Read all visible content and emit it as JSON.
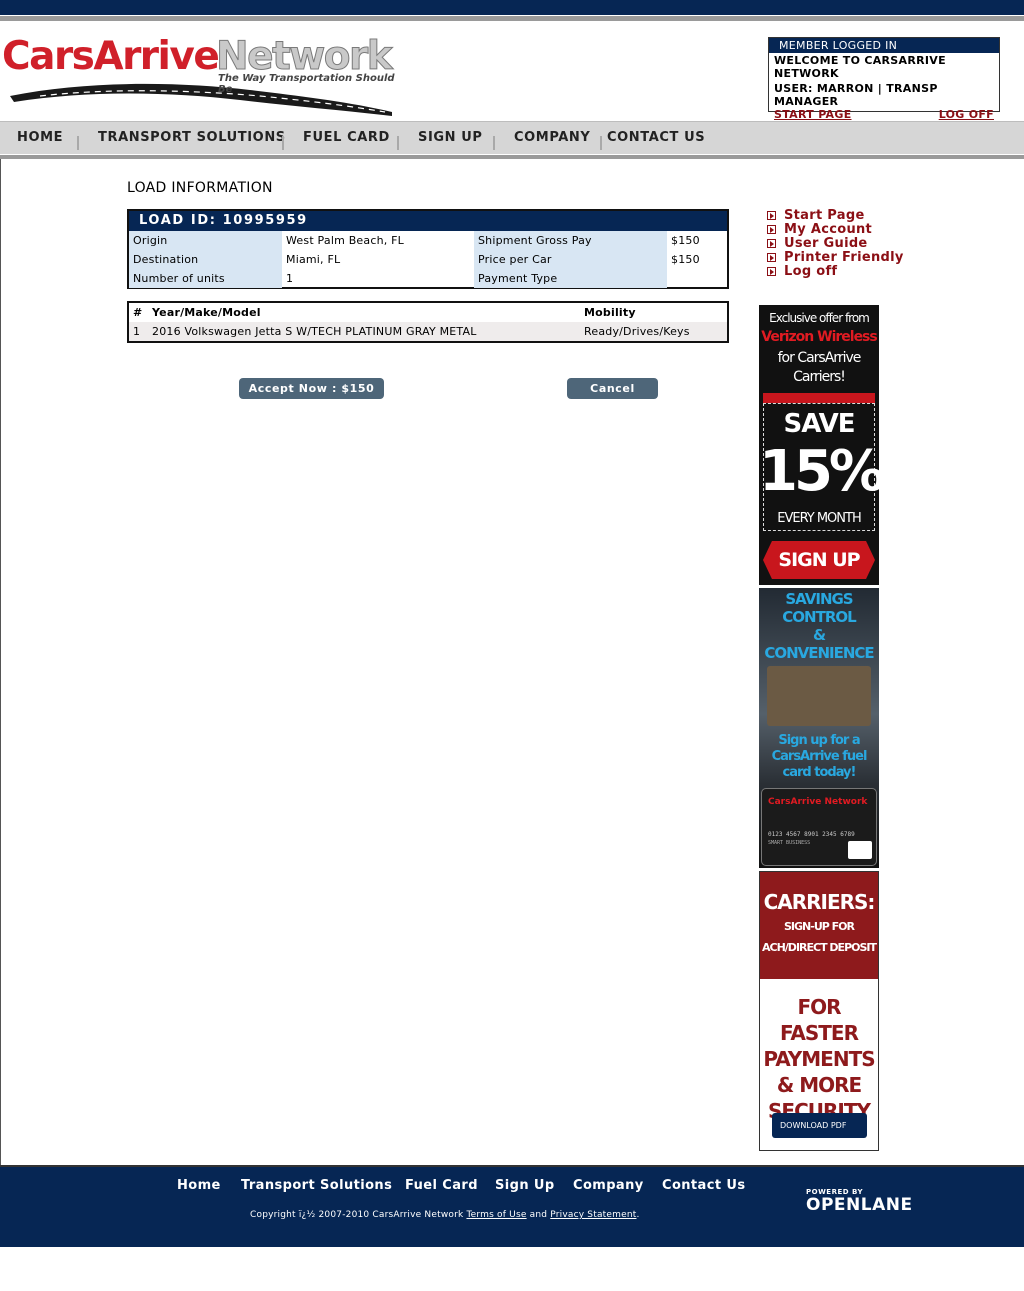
{
  "header": {
    "logo_part1": "CarsArrive",
    "logo_part2": "Network",
    "tagline": "The Way Transportation Should Be"
  },
  "member": {
    "title": "MEMBER LOGGED IN",
    "welcome": "WELCOME TO CARSARRIVE NETWORK",
    "user": "USER: MARRON | TRANSP MANAGER",
    "start_page": "START PAGE",
    "log_off": "LOG OFF"
  },
  "nav": [
    "HOME",
    "TRANSPORT SOLUTIONS",
    "FUEL CARD",
    "SIGN UP",
    "COMPANY",
    "CONTACT US"
  ],
  "main": {
    "title": "LOAD INFORMATION",
    "load_id": "LOAD ID: 10995959",
    "rows": [
      {
        "label1": "Origin",
        "value1": "West Palm Beach, FL",
        "label2": "Shipment Gross Pay",
        "value2": "$150"
      },
      {
        "label1": "Destination",
        "value1": "Miami, FL",
        "label2": "Price per Car",
        "value2": "$150"
      },
      {
        "label1": "Number of units",
        "value1": "1",
        "label2": "Payment Type",
        "value2": ""
      }
    ],
    "vehicles": {
      "headers": [
        "#",
        "Year/Make/Model",
        "Mobility"
      ],
      "rows": [
        {
          "num": "1",
          "ymm": "2016 Volkswagen Jetta S W/TECH PLATINUM GRAY METAL",
          "mobility": "Ready/Drives/Keys"
        }
      ]
    },
    "accept_label": "Accept Now : $150",
    "cancel_label": "Cancel"
  },
  "sidebar": {
    "links": [
      "Start Page",
      "My Account",
      "User Guide",
      "Printer Friendly",
      "Log off"
    ]
  },
  "ads": {
    "ad1": {
      "line1": "Exclusive offer from",
      "line2": "Verizon Wireless",
      "line3": "for CarsArrive",
      "line4": "Carriers!",
      "save": "SAVE",
      "pct": "15%",
      "every": "EVERY MONTH",
      "cta": "SIGN UP"
    },
    "ad2": {
      "head": [
        "SAVINGS",
        "CONTROL",
        "& CONVENIENCE"
      ],
      "sub": [
        "Sign up for a",
        "CarsArrive fuel",
        "card today!"
      ],
      "card_brand": "CarsArrive Network",
      "card_num": "0123 4567 8901 2345 6789",
      "card_label": "SMART BUSINESS"
    },
    "ad3": {
      "head": "CARRIERS:",
      "sub1": "SIGN-UP FOR",
      "sub2": "ACH/DIRECT DEPOSIT",
      "body": [
        "FOR FASTER",
        "PAYMENTS",
        "& MORE",
        "SECURITY"
      ],
      "cta": "DOWNLOAD PDF"
    }
  },
  "footer": {
    "links": [
      "Home",
      "Transport Solutions",
      "Fuel Card",
      "Sign Up",
      "Company",
      "Contact Us"
    ],
    "copy_prefix": "Copyright ï¿½ 2007-2010 CarsArrive Network",
    "terms": "Terms of Use",
    "and": "and",
    "privacy": "Privacy Statement",
    "powered_by": "POWERED BY",
    "powered_brand": "OPENLANE"
  },
  "colors": {
    "navy": "#062654",
    "brand_red": "#d0202a",
    "link_red": "#8b0f15",
    "button": "#4e6679",
    "label_bg": "#d8e6f3"
  }
}
